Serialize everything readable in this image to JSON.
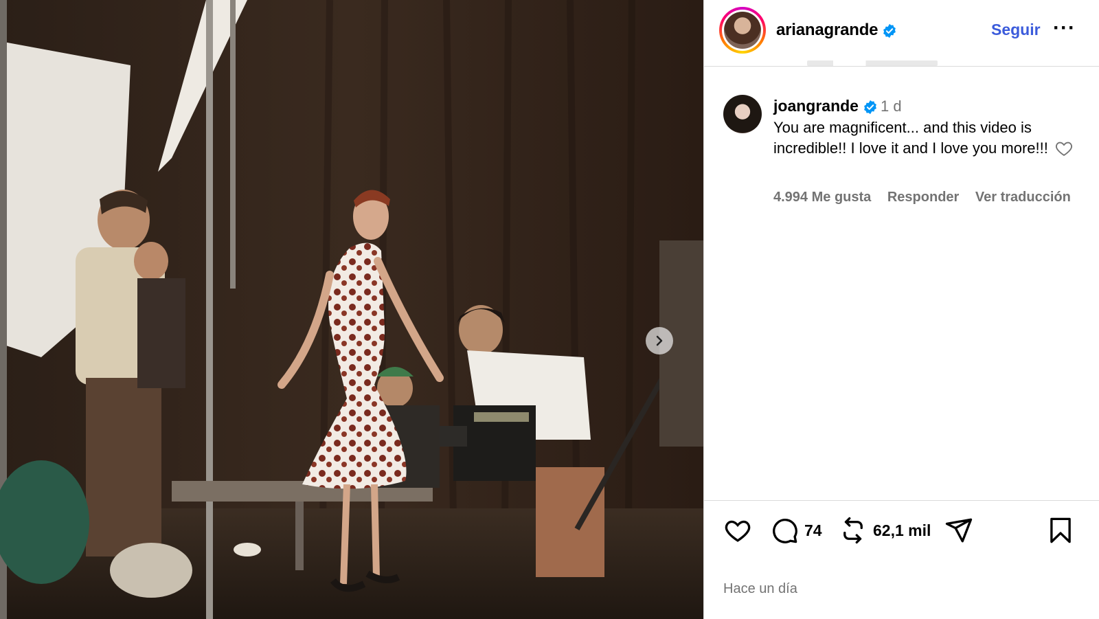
{
  "post": {
    "author": "arianagrande",
    "follow_label": "Seguir",
    "more_label": "···"
  },
  "comment": {
    "username": "joangrande",
    "time": "1 d",
    "text": "You are magnificent... and this video is incredible!! I love it and I love you more!!!",
    "likes": "4.994 Me gusta",
    "reply_label": "Responder",
    "translate_label": "Ver traducción"
  },
  "actions": {
    "comments_count": "74",
    "reposts_count": "62,1 mil"
  },
  "timestamp": "Hace un día",
  "colors": {
    "accent": "#3b5bdb",
    "verified": "#0095f6",
    "muted": "#737373",
    "border": "#dbdbdb"
  }
}
